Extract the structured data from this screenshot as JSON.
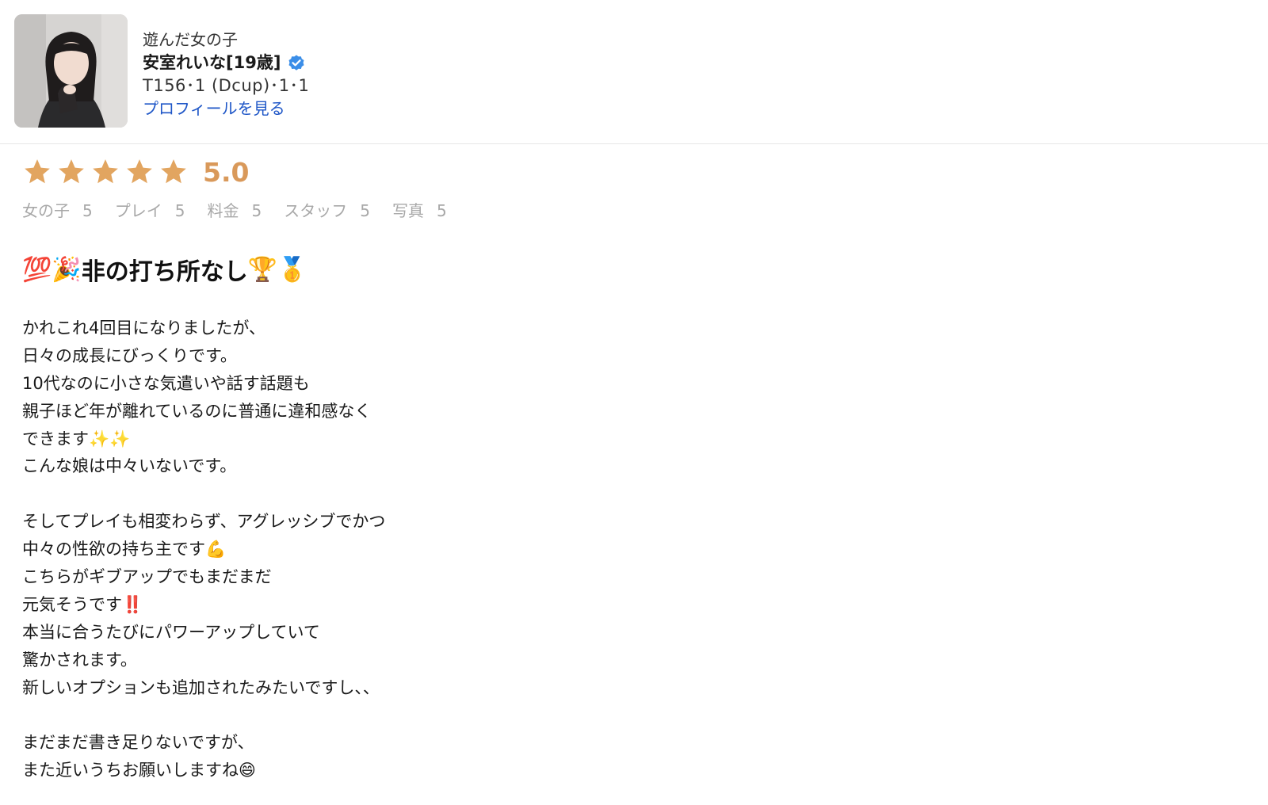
{
  "header": {
    "caption": "遊んだ女の子",
    "name": "安室れいな[19歳]",
    "stats": "T156･1 (Dcup)･1･1",
    "profile_link": "プロフィールを見る",
    "verified_icon": "verified-check-icon",
    "verified_color": "#3b8ee8"
  },
  "rating": {
    "stars": 5,
    "score": "5.0",
    "star_color": "#e2a560",
    "sub": [
      {
        "label": "女の子",
        "value": "5"
      },
      {
        "label": "プレイ",
        "value": "5"
      },
      {
        "label": "料金",
        "value": "5"
      },
      {
        "label": "スタッフ",
        "value": "5"
      },
      {
        "label": "写真",
        "value": "5"
      }
    ]
  },
  "review": {
    "title_prefix": "💯🎉",
    "title": "非の打ち所なし",
    "title_suffix": "🏆🥇",
    "paragraphs": [
      [
        "かれこれ4回目になりましたが、",
        "日々の成長にびっくりです。",
        "10代なのに小さな気遣いや話す話題も",
        "親子ほど年が離れているのに普通に違和感なく",
        "できます✨✨",
        "こんな娘は中々いないです。"
      ],
      [
        "そしてプレイも相変わらず、アグレッシブでかつ",
        "中々の性欲の持ち主です💪",
        "こちらがギブアップでもまだまだ",
        "元気そうです‼️",
        "本当に合うたびにパワーアップしていて",
        "驚かされます。",
        "新しいオプションも追加されたみたいですし、、"
      ],
      [
        "まだまだ書き足りないですが、",
        "また近いうちお願いしますね😄"
      ]
    ]
  }
}
